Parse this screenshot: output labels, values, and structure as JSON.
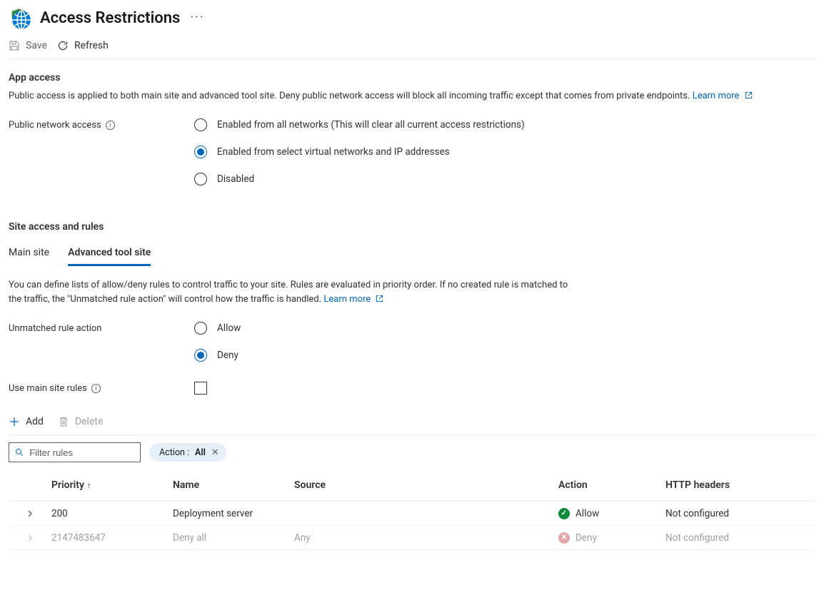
{
  "header": {
    "title": "Access Restrictions"
  },
  "commands": {
    "save": "Save",
    "refresh": "Refresh"
  },
  "app_access": {
    "heading": "App access",
    "description": "Public access is applied to both main site and advanced tool site. Deny public network access will block all incoming traffic except that comes from private endpoints.",
    "learn_more": "Learn more",
    "label": "Public network access",
    "options": {
      "all": "Enabled from all networks (This will clear all current access restrictions)",
      "select": "Enabled from select virtual networks and IP addresses",
      "disabled": "Disabled"
    }
  },
  "site_rules": {
    "heading": "Site access and rules",
    "tabs": {
      "main": "Main site",
      "adv": "Advanced tool site"
    },
    "description": "You can define lists of allow/deny rules to control traffic to your site. Rules are evaluated in priority order. If no created rule is matched to the traffic, the \"Unmatched rule action\" will control how the traffic is handled.",
    "learn_more": "Learn more",
    "unmatched_label": "Unmatched rule action",
    "unmatched_options": {
      "allow": "Allow",
      "deny": "Deny"
    },
    "use_main_label": "Use main site rules"
  },
  "table": {
    "toolbar": {
      "add": "Add",
      "delete": "Delete"
    },
    "filter_placeholder": "Filter rules",
    "chip": {
      "prefix": "Action : ",
      "value": "All"
    },
    "columns": {
      "priority": "Priority",
      "name": "Name",
      "source": "Source",
      "action": "Action",
      "http": "HTTP headers"
    },
    "rows": [
      {
        "priority": "200",
        "name": "Deployment server",
        "source": "",
        "action_kind": "allow",
        "action_label": "Allow",
        "http": "Not configured"
      },
      {
        "priority": "2147483647",
        "name": "Deny all",
        "source": "Any",
        "action_kind": "deny",
        "action_label": "Deny",
        "http": "Not configured",
        "muted": true
      }
    ]
  }
}
